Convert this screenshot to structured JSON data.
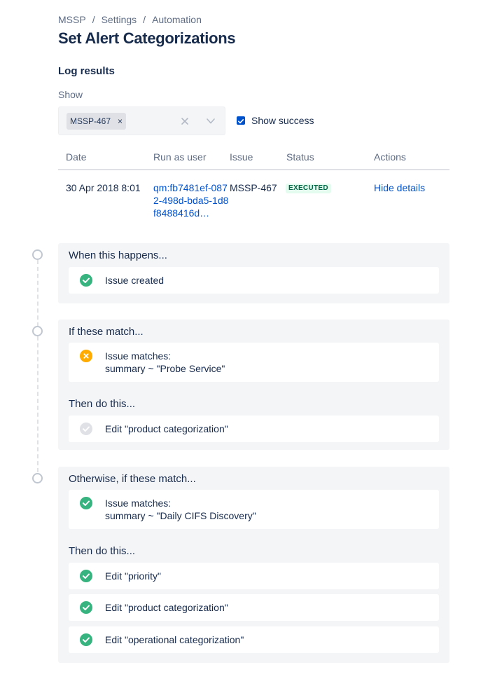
{
  "breadcrumb": [
    "MSSP",
    "Settings",
    "Automation"
  ],
  "breadcrumb_separator": "/",
  "page_title": "Set Alert Categorizations",
  "log": {
    "title": "Log results",
    "show_label": "Show",
    "filter_tag": "MSSP-467",
    "tag_remove": "×",
    "show_success_label": "Show success",
    "show_success_checked": true,
    "columns": [
      "Date",
      "Run as user",
      "Issue",
      "Status",
      "Actions"
    ],
    "row": {
      "date": "30 Apr 2018 8:01",
      "run_as_user": "qm:fb7481ef-0872-498d-bda5-1d8f8488416d…",
      "issue": "MSSP-467",
      "status": "EXECUTED",
      "action": "Hide details"
    }
  },
  "rule": {
    "trigger": {
      "heading": "When this happens...",
      "items": [
        {
          "text": "Issue created",
          "status": "success"
        }
      ]
    },
    "condition_1": {
      "heading": "If these match...",
      "items": [
        {
          "line1": "Issue matches:",
          "line2": "summary ~ \"Probe Service\"",
          "status": "no-match"
        }
      ],
      "then_heading": "Then do this...",
      "actions": [
        {
          "text": "Edit \"product categorization\"",
          "status": "skipped"
        }
      ]
    },
    "condition_2": {
      "heading": "Otherwise, if these match...",
      "items": [
        {
          "line1": "Issue matches:",
          "line2": "summary ~ \"Daily CIFS Discovery\"",
          "status": "success"
        }
      ],
      "then_heading": "Then do this...",
      "actions": [
        {
          "text": "Edit \"priority\"",
          "status": "success"
        },
        {
          "text": "Edit \"product categorization\"",
          "status": "success"
        },
        {
          "text": "Edit \"operational categorization\"",
          "status": "success"
        }
      ]
    }
  },
  "colors": {
    "success": "#36b37e",
    "no_match": "#ffab00",
    "skipped": "#dfe1e6",
    "link": "#0052cc",
    "lozenge_bg": "#e3fcef",
    "lozenge_text": "#006644"
  }
}
